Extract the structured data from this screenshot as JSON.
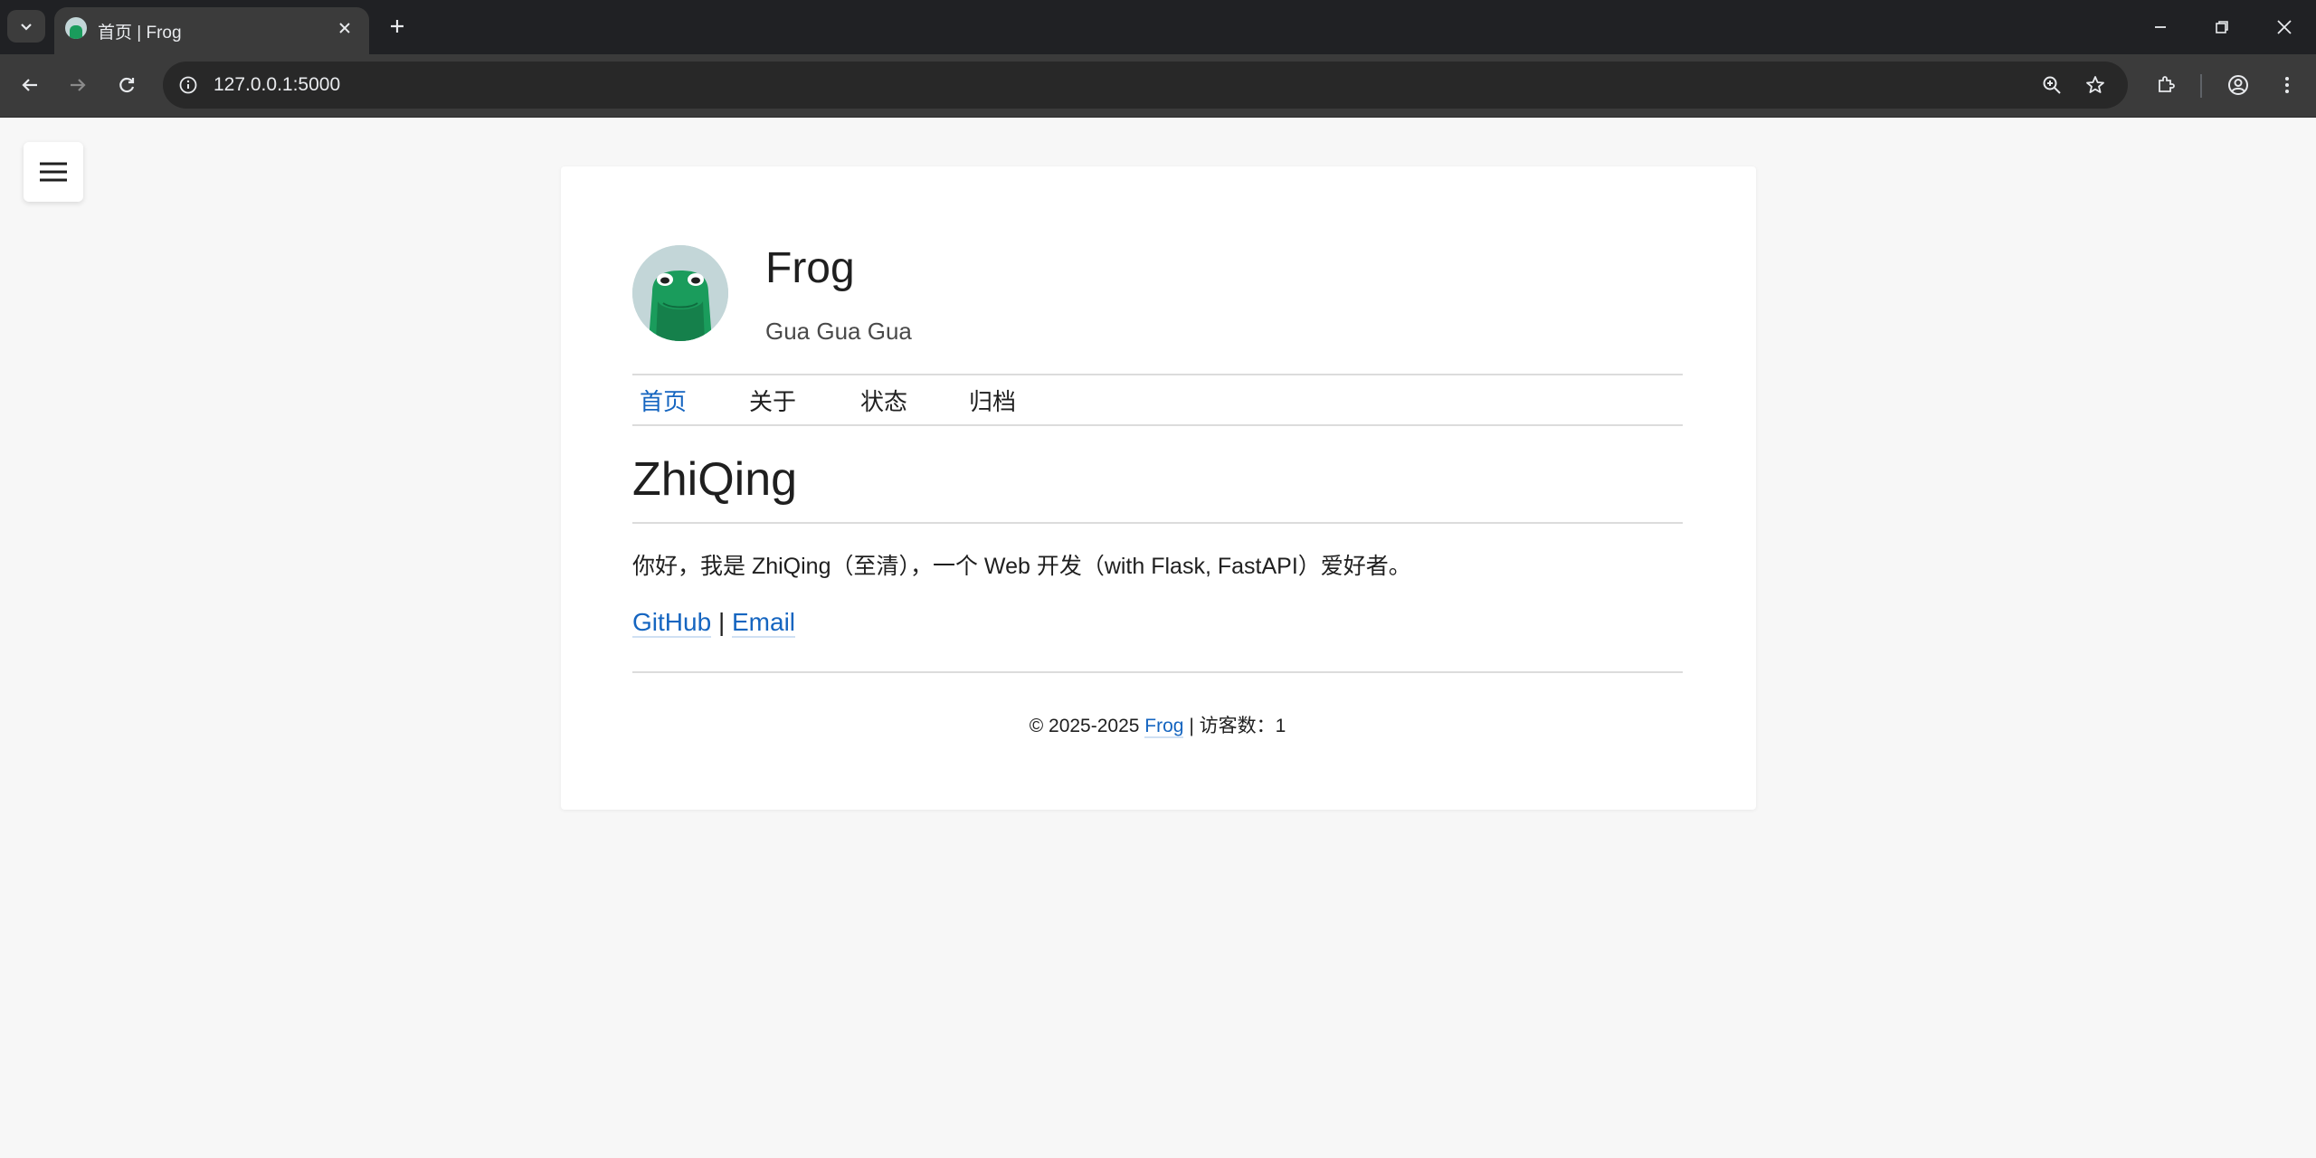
{
  "browser": {
    "tab_title": "首页 | Frog",
    "url": "127.0.0.1:5000"
  },
  "site": {
    "title": "Frog",
    "subtitle": "Gua Gua Gua"
  },
  "nav": {
    "items": [
      {
        "label": "首页",
        "active": true
      },
      {
        "label": "关于",
        "active": false
      },
      {
        "label": "状态",
        "active": false
      },
      {
        "label": "归档",
        "active": false
      }
    ]
  },
  "main": {
    "heading": "ZhiQing",
    "intro": "你好，我是 ZhiQing（至清），一个 Web 开发（with Flask, FastAPI）爱好者。",
    "links": {
      "github": "GitHub",
      "separator": "|",
      "email": "Email"
    }
  },
  "footer": {
    "copyright": "© 2025-2025",
    "site_link": "Frog",
    "visitors": "| 访客数：1"
  },
  "colors": {
    "accent": "#1565c0",
    "chrome_dark": "#202124",
    "chrome_toolbar": "#3b3b3b",
    "page_bg": "#f7f7f7",
    "frog_green": "#1a9c5c"
  }
}
